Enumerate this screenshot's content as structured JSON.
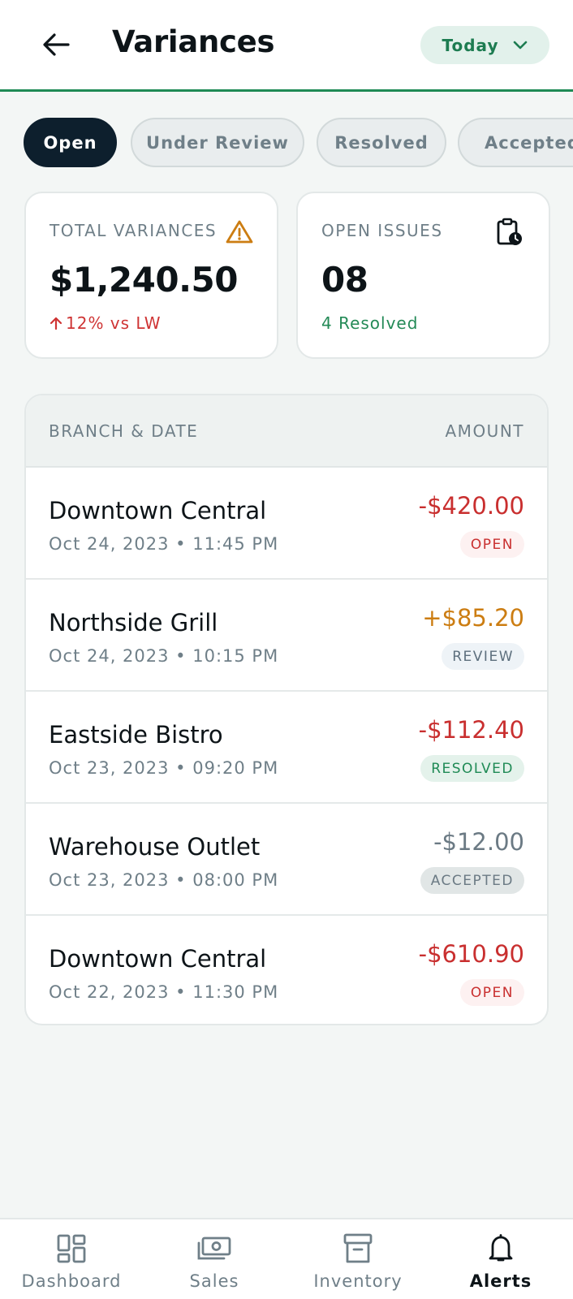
{
  "header": {
    "title": "Variances",
    "date_filter": "Today"
  },
  "tabs": [
    {
      "label": "Open",
      "active": true
    },
    {
      "label": "Under Review",
      "active": false
    },
    {
      "label": "Resolved",
      "active": false
    },
    {
      "label": "Accepted",
      "active": false
    }
  ],
  "summary": {
    "total_variances": {
      "label": "TOTAL VARIANCES",
      "value": "$1,240.50",
      "change": "12% vs LW",
      "icon": "warning-icon"
    },
    "open_issues": {
      "label": "OPEN ISSUES",
      "value": "08",
      "sub": "4 Resolved",
      "icon": "clipboard-clock-icon"
    }
  },
  "table": {
    "col_branch": "BRANCH & DATE",
    "col_amount": "AMOUNT",
    "rows": [
      {
        "branch": "Downtown Central",
        "date": "Oct 24, 2023 • 11:45 PM",
        "amount": "-$420.00",
        "status": "OPEN"
      },
      {
        "branch": "Northside Grill",
        "date": "Oct 24, 2023 • 10:15 PM",
        "amount": "+$85.20",
        "status": "REVIEW"
      },
      {
        "branch": "Eastside Bistro",
        "date": "Oct 23, 2023 • 09:20 PM",
        "amount": "-$112.40",
        "status": "RESOLVED"
      },
      {
        "branch": "Warehouse Outlet",
        "date": "Oct 23, 2023 • 08:00 PM",
        "amount": "-$12.00",
        "status": "ACCEPTED"
      },
      {
        "branch": "Downtown Central",
        "date": "Oct 22, 2023 • 11:30 PM",
        "amount": "-$610.90",
        "status": "OPEN"
      }
    ]
  },
  "nav": [
    {
      "label": "Dashboard",
      "icon": "dashboard-icon",
      "active": false
    },
    {
      "label": "Sales",
      "icon": "cash-icon",
      "active": false
    },
    {
      "label": "Inventory",
      "icon": "archive-box-icon",
      "active": false
    },
    {
      "label": "Alerts",
      "icon": "bell-icon",
      "active": true
    }
  ],
  "colors": {
    "accent_green": "#1f8a55",
    "negative_red": "#c92f2f",
    "warning_orange": "#cc7d12",
    "active_tab": "#0d1f2d"
  }
}
